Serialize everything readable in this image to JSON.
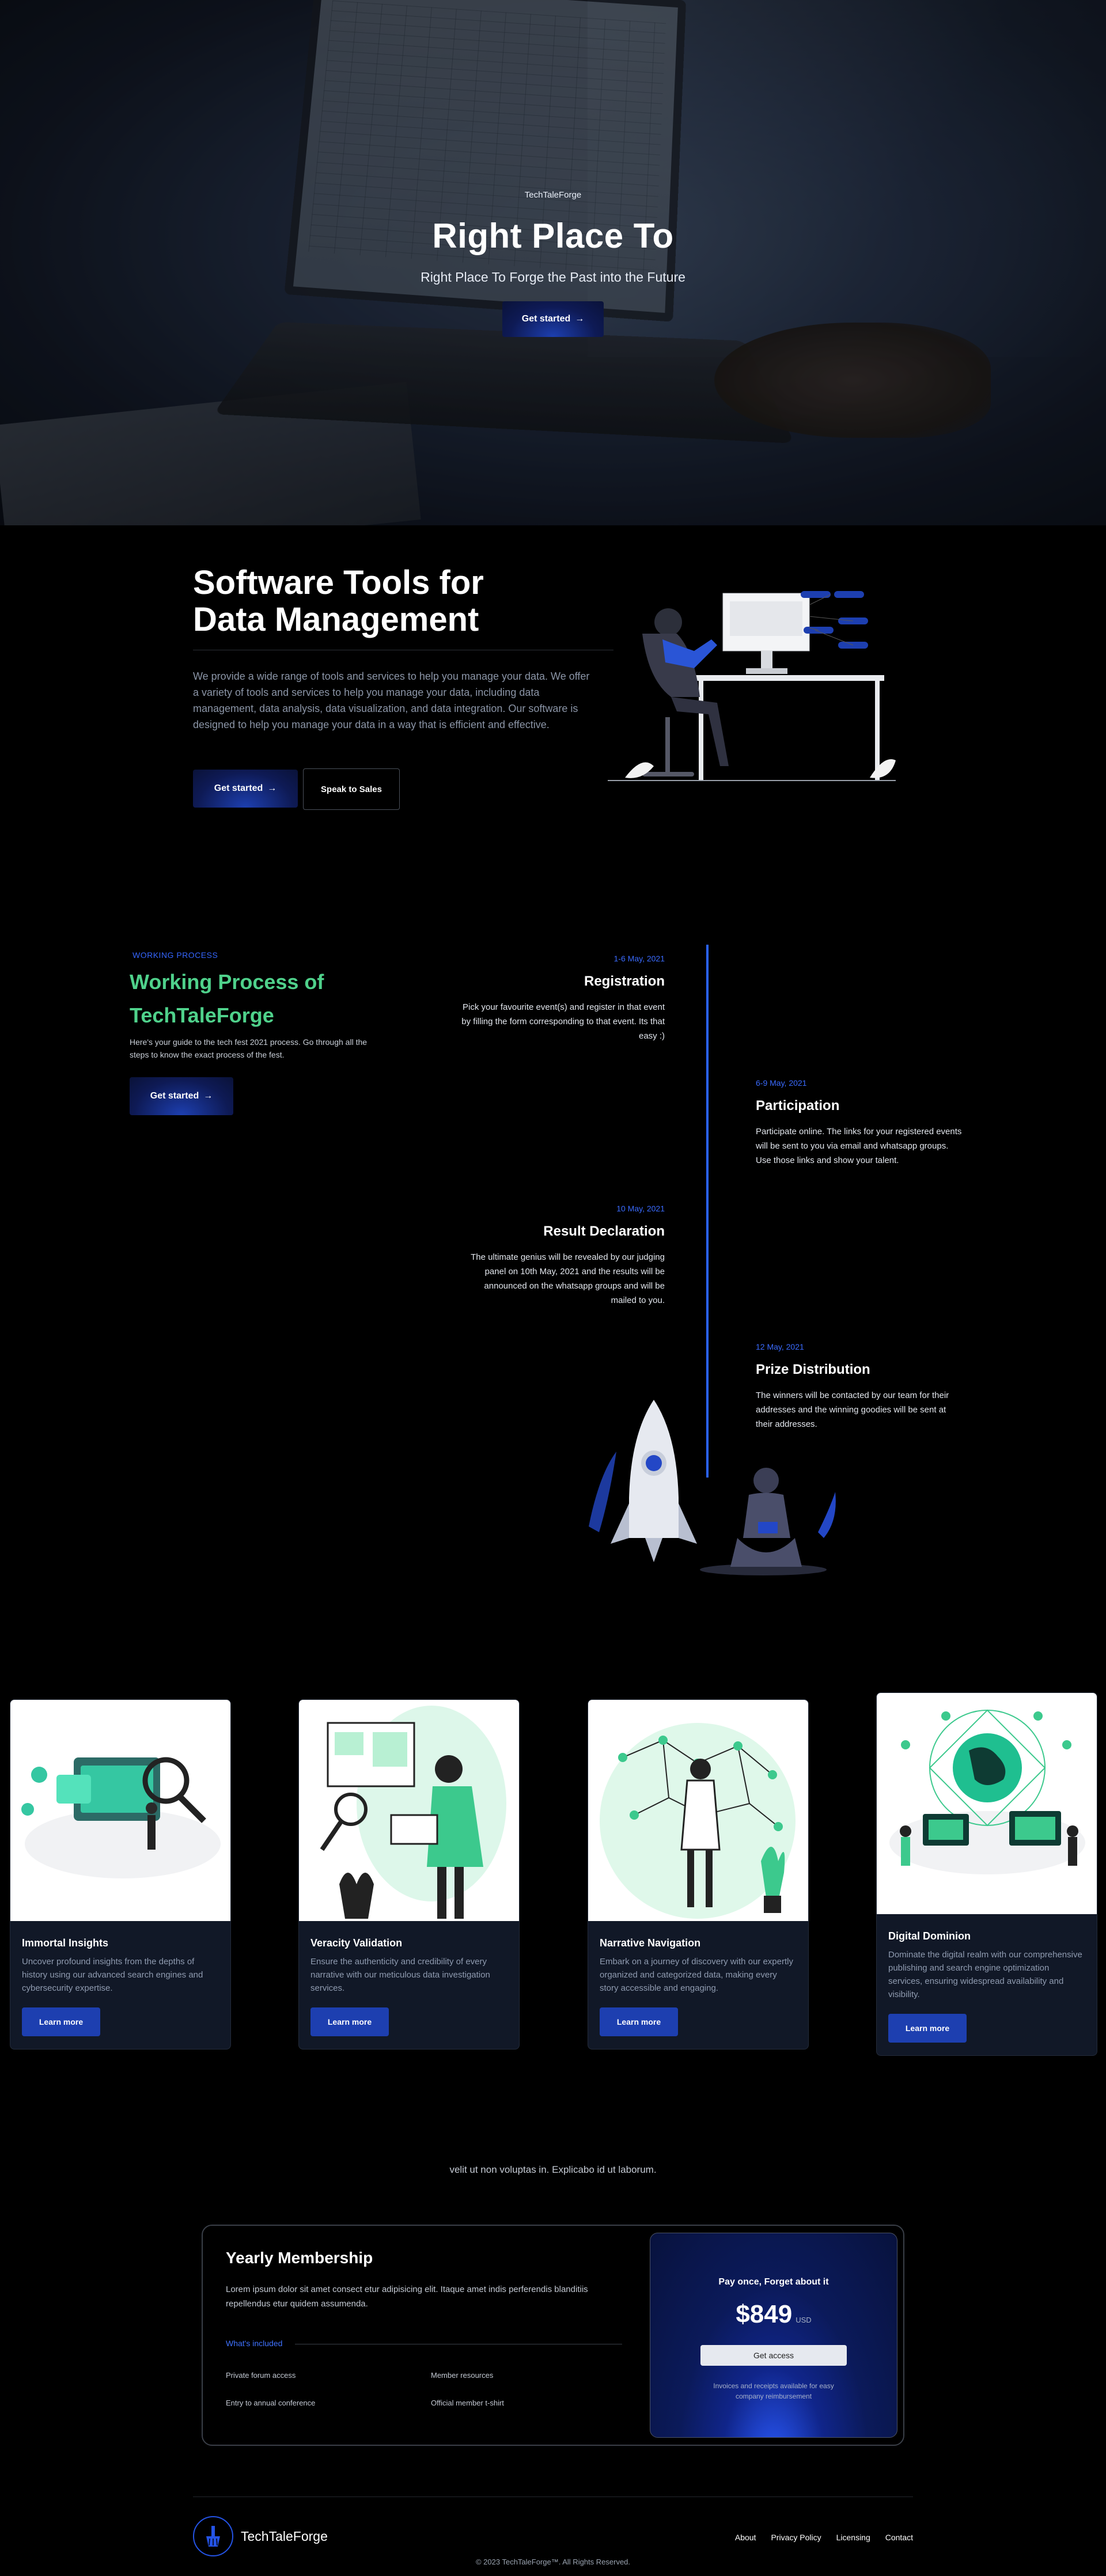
{
  "hero": {
    "brand": "TechTaleForge",
    "title": "Right Place To",
    "subtitle": "Right Place To Forge the Past into the Future",
    "cta": "Get started"
  },
  "tools": {
    "title_line1": "Software Tools for",
    "title_line2": "Data Management",
    "description": "We provide a wide range of tools and services to help you manage your data. We offer a variety of tools and services to help you manage your data, including data management, data analysis, data visualization, and data integration. Our software is designed to help you manage your data in a way that is efficient and effective.",
    "primary": "Get started",
    "secondary": "Speak to Sales"
  },
  "process": {
    "tag": "WORKING PROCESS",
    "title_line1": "Working Process of",
    "title_line2": "TechTaleForge",
    "description": "Here's your guide to the tech fest 2021 process. Go through all the steps to know the exact process of the fest.",
    "cta": "Get started",
    "items": [
      {
        "date": "1-6 May, 2021",
        "title": "Registration",
        "body": "Pick your favourite event(s) and register in that event by filling the form corresponding to that event. Its that easy :)"
      },
      {
        "date": "6-9 May, 2021",
        "title": "Participation",
        "body": "Participate online. The links for your registered events will be sent to you via email and whatsapp groups. Use those links and show your talent."
      },
      {
        "date": "10 May, 2021",
        "title": "Result Declaration",
        "body": "The ultimate genius will be revealed by our judging panel on 10th May, 2021 and the results will be announced on the whatsapp groups and will be mailed to you."
      },
      {
        "date": "12 May, 2021",
        "title": "Prize Distribution",
        "body": "The winners will be contacted by our team for their addresses and the winning goodies will be sent at their addresses."
      }
    ]
  },
  "cards": [
    {
      "title": "Immortal Insights",
      "body": "Uncover profound insights from the depths of history using our advanced search engines and cybersecurity expertise.",
      "button": "Learn more"
    },
    {
      "title": "Veracity Validation",
      "body": "Ensure the authenticity and credibility of every narrative with our meticulous data investigation services.",
      "button": "Learn more"
    },
    {
      "title": "Narrative Navigation",
      "body": "Embark on a journey of discovery with our expertly organized and categorized data, making every story accessible and engaging.",
      "button": "Learn more"
    },
    {
      "title": "Digital Dominion",
      "body": "Dominate the digital realm with our comprehensive publishing and search engine optimization services, ensuring widespread availability and visibility.",
      "button": "Learn more"
    }
  ],
  "tagline": "velit ut non voluptas in. Explicabo id ut laborum.",
  "membership": {
    "title": "Yearly Membership",
    "description": "Lorem ipsum dolor sit amet consect etur adipisicing elit. Itaque amet indis perferendis blanditiis repellendus etur quidem assumenda.",
    "included_label": "What's included",
    "features": [
      "Private forum access",
      "Member resources",
      "Entry to annual conference",
      "Official member t-shirt"
    ],
    "price_heading": "Pay once, Forget about it",
    "price": "$849",
    "currency": "USD",
    "button": "Get access",
    "note": "Invoices and receipts available for easy company reimbursement"
  },
  "footer": {
    "brand": "TechTaleForge",
    "links": [
      "About",
      "Privacy Policy",
      "Licensing",
      "Contact"
    ],
    "copyright": "© 2023 TechTaleForge™. All Rights Reserved."
  },
  "colors": {
    "accent": "#1d3fb0",
    "timeline": "#2a63ff",
    "process_title": "#4fd18b",
    "card_bg": "#111827"
  }
}
